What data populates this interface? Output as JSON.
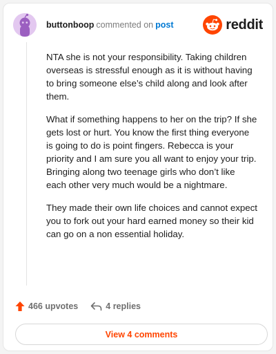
{
  "header": {
    "author": "buttonboop",
    "action_text": "commented on",
    "post_link": "post",
    "brand": "reddit"
  },
  "comment": {
    "paragraphs": [
      "NTA she is not your responsibility. Taking children overseas is stressful enough as it is without having to bring someone else’s child along and look after them.",
      "What if something happens to her on the trip? If she gets lost or hurt. You know the first thing everyone is going to do is point fingers. Rebecca is your priority and I am sure you all want to enjoy your trip. Bringing along two teenage girls who don’t like each other very much would be a nightmare.",
      "They made their own life choices and cannot expect you to fork out your hard earned money so their kid can go on a non essential holiday."
    ]
  },
  "actions": {
    "upvotes": "466 upvotes",
    "replies": "4 replies"
  },
  "footer": {
    "view_comments": "View 4 comments"
  },
  "colors": {
    "accent": "#ff4500",
    "link": "#0079d3",
    "avatar_bg": "#e3c8f0",
    "avatar_figure": "#9b5fc0"
  },
  "icons": {
    "avatar": "snoo-avatar-icon",
    "logo": "reddit-snoo-icon",
    "upvote": "upvote-arrow-icon",
    "reply": "reply-arrow-icon"
  }
}
